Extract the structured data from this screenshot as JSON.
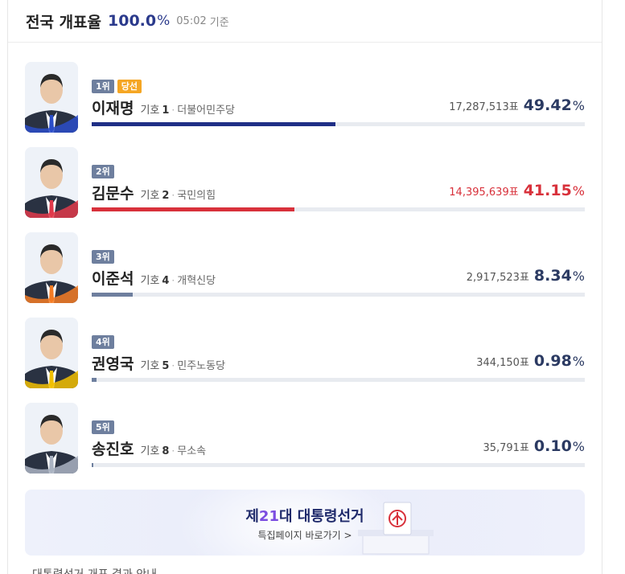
{
  "header": {
    "title": "전국 개표율",
    "percent": "100.0",
    "percent_sign": "%",
    "time": "05:02",
    "basis": "기준"
  },
  "candidates": [
    {
      "rank": "1위",
      "winner_label": "당선",
      "name": "이재명",
      "giho_label": "기호",
      "number": "1",
      "party": "더불어민주당",
      "votes": "17,287,513표",
      "percent": "49.42",
      "percent_sign": "%",
      "share": 0.4942,
      "bar_color": "#1f2f86",
      "text_color": "#2b3a62",
      "photo_accent": "#2b4ec9"
    },
    {
      "rank": "2위",
      "name": "김문수",
      "giho_label": "기호",
      "number": "2",
      "party": "국민의힘",
      "votes": "14,395,639표",
      "percent": "41.15",
      "percent_sign": "%",
      "share": 0.4115,
      "bar_color": "#d8313b",
      "text_color": "#d8313b",
      "photo_accent": "#e0394a"
    },
    {
      "rank": "3위",
      "name": "이준석",
      "giho_label": "기호",
      "number": "4",
      "party": "개혁신당",
      "votes": "2,917,523표",
      "percent": "8.34",
      "percent_sign": "%",
      "share": 0.0834,
      "bar_color": "#6e7f9e",
      "text_color": "#2b3a62",
      "photo_accent": "#f47c25"
    },
    {
      "rank": "4위",
      "name": "권영국",
      "giho_label": "기호",
      "number": "5",
      "party": "민주노동당",
      "votes": "344,150표",
      "percent": "0.98",
      "percent_sign": "%",
      "share": 0.0098,
      "bar_color": "#6e7f9e",
      "text_color": "#2b3a62",
      "photo_accent": "#f2c000"
    },
    {
      "rank": "5위",
      "name": "송진호",
      "giho_label": "기호",
      "number": "8",
      "party": "무소속",
      "votes": "35,791표",
      "percent": "0.10",
      "percent_sign": "%",
      "share": 0.001,
      "bar_color": "#6e7f9e",
      "text_color": "#2b3a62",
      "photo_accent": "#aab3c2"
    }
  ],
  "banner": {
    "title_prefix": "제",
    "title_number": "21",
    "title_suffix": "대 대통령선거",
    "subtitle": "특집페이지 바로가기 >"
  },
  "bottom": {
    "text": "대통령선거 개표 결과 안내"
  }
}
